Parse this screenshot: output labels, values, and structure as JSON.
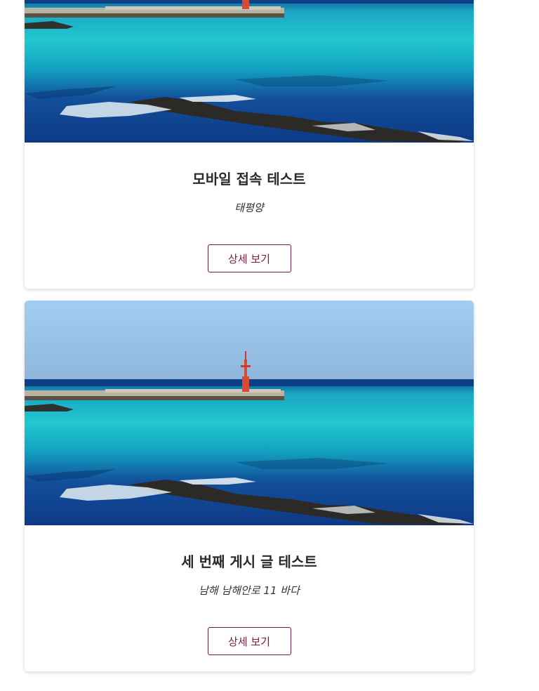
{
  "posts": [
    {
      "title": "모바일 접속 테스트",
      "location": "태평양",
      "button_label": "상세 보기",
      "image_icon": "seaside-lighthouse-photo"
    },
    {
      "title": "세 번째 게시 글 테스트",
      "location": "남해 남해안로 11 바다",
      "button_label": "상세 보기",
      "image_icon": "seaside-lighthouse-photo"
    }
  ],
  "colors": {
    "button_border": "#7a1a4a",
    "button_text": "#7a1a4a",
    "title_text": "#2a2a2a",
    "sky": "#a8d0f0",
    "turquoise_sea": "#18c0c8",
    "deep_sea": "#0e3f8a"
  }
}
